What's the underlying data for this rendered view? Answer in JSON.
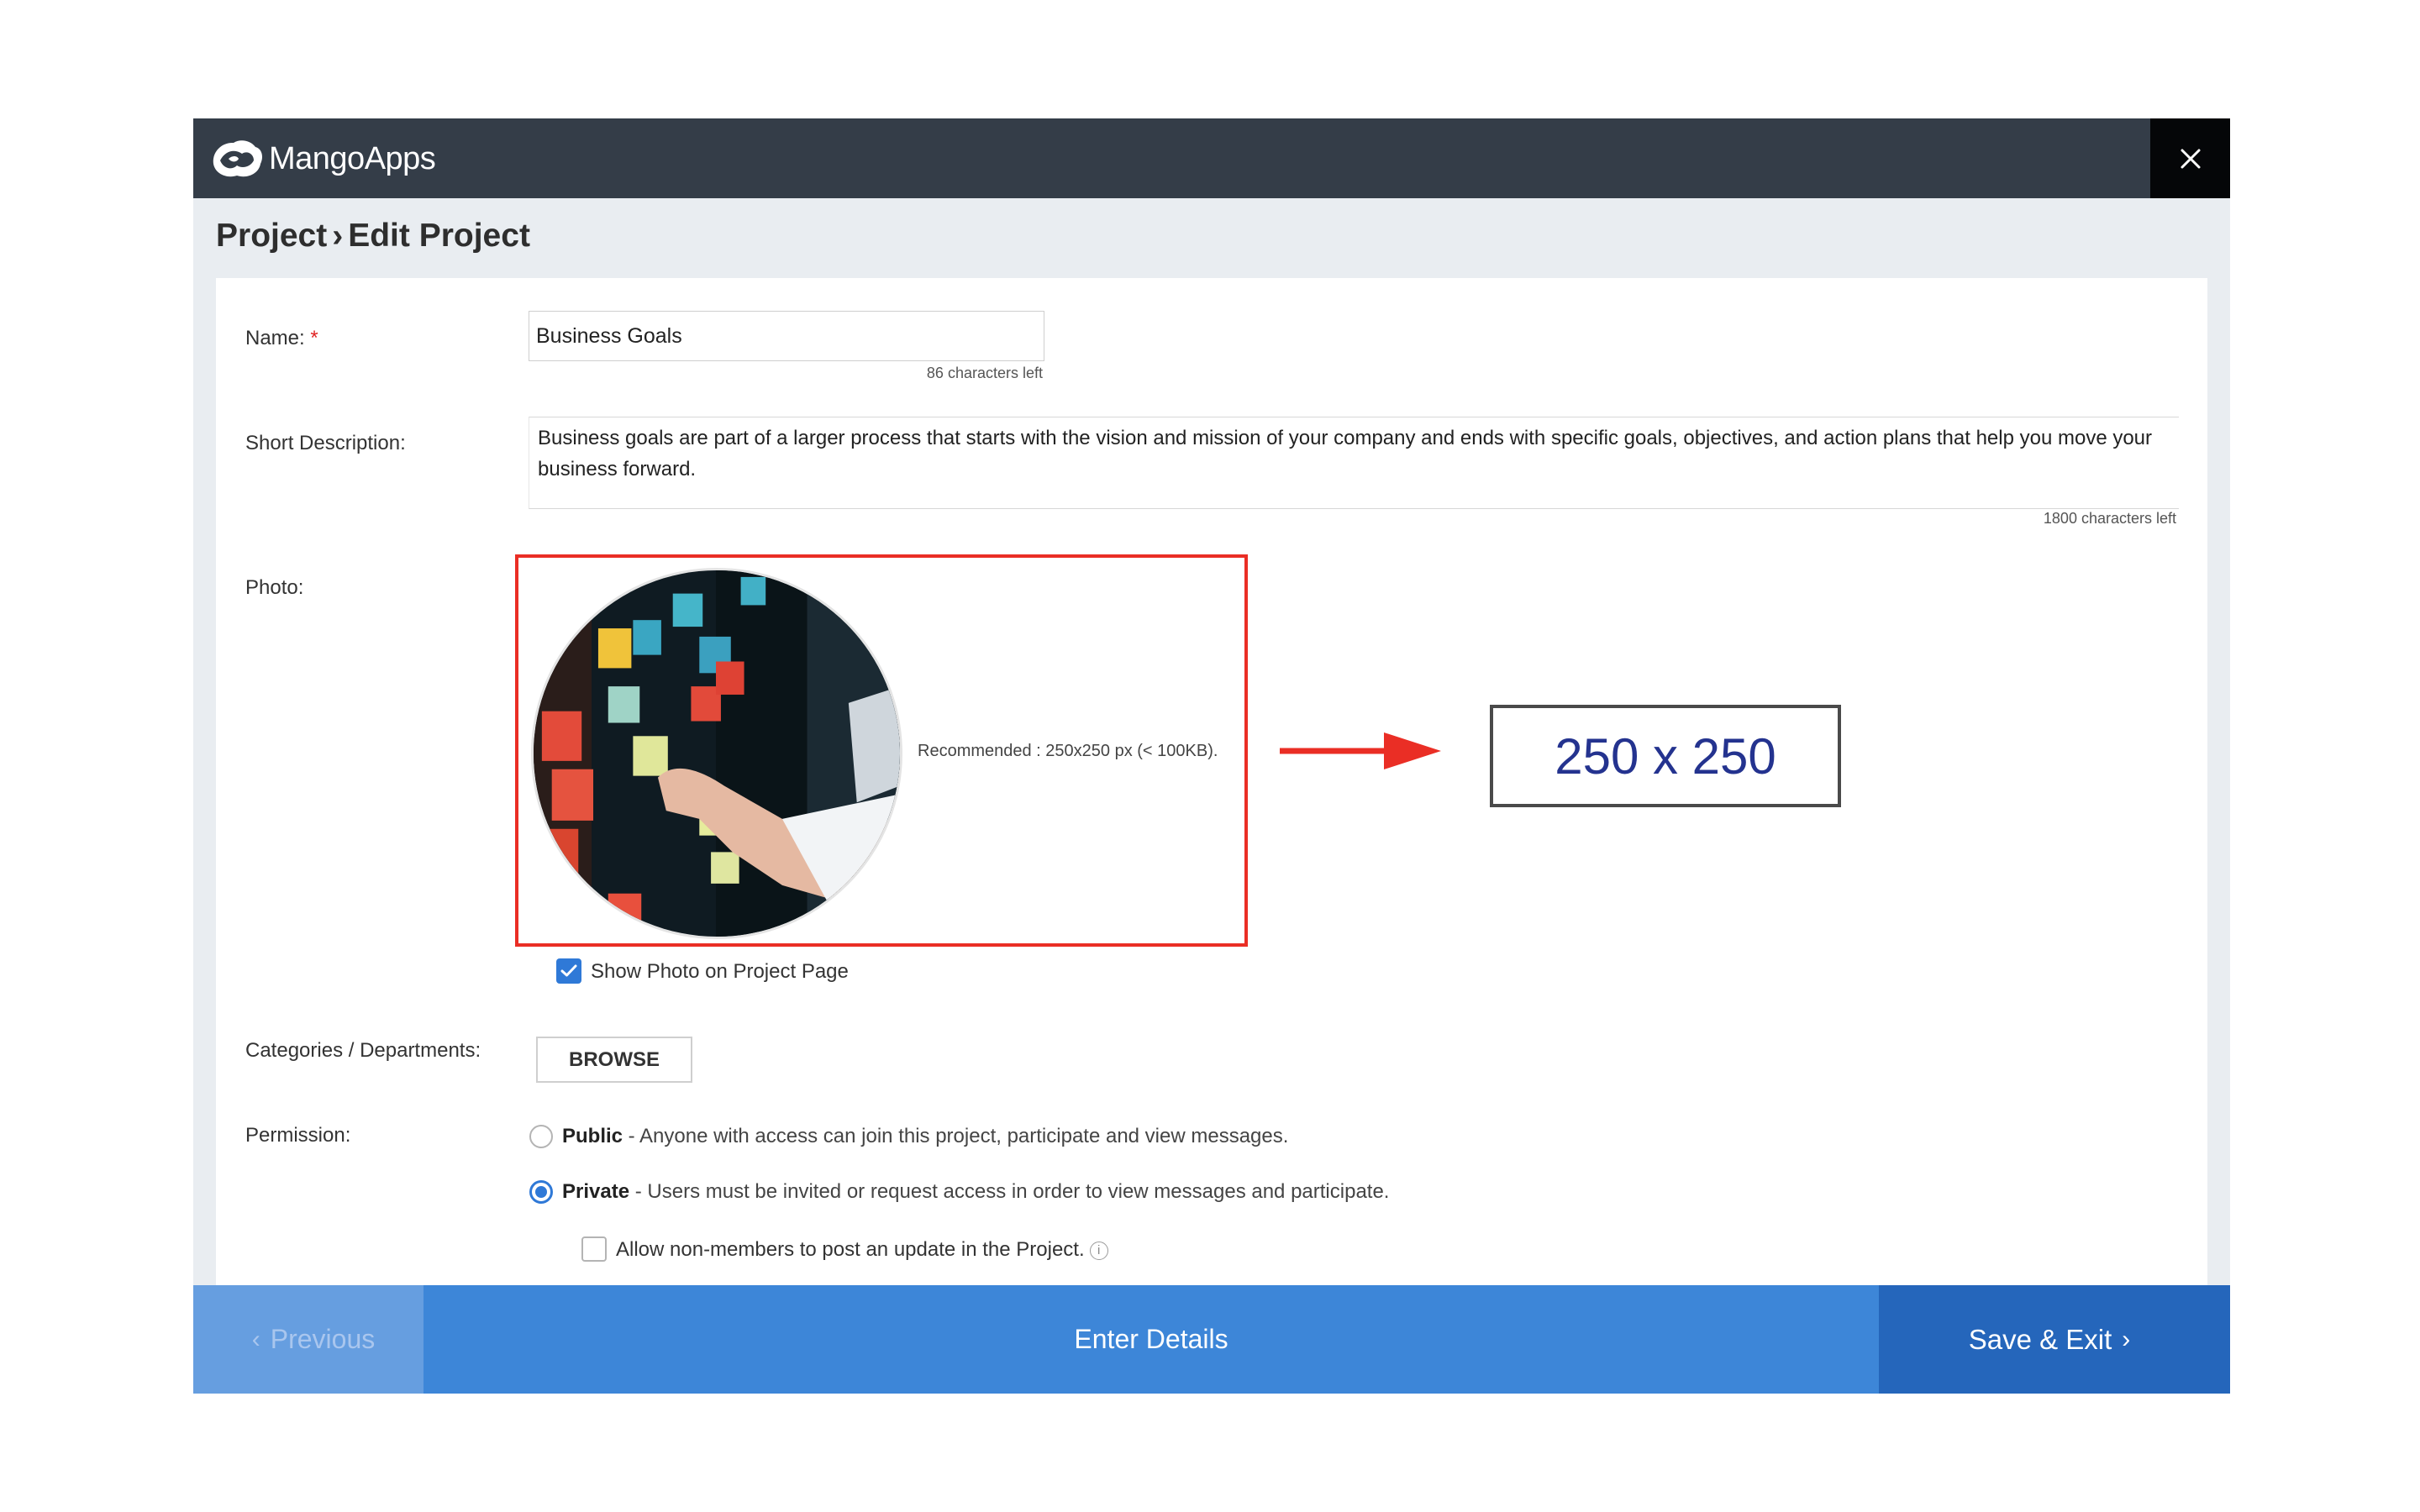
{
  "app": {
    "name": "MangoApps"
  },
  "breadcrumb": {
    "parent": "Project",
    "separator": "›",
    "current": "Edit Project"
  },
  "form": {
    "name": {
      "label": "Name:",
      "required_mark": "*",
      "value": "Business Goals",
      "counter": "86 characters left"
    },
    "short_description": {
      "label": "Short Description:",
      "value": "Business goals are part of a larger process that starts with the vision and mission of your company and ends with specific goals, objectives, and action plans that help you move your business forward.",
      "counter": "1800 characters left"
    },
    "photo": {
      "label": "Photo:",
      "recommendation": "Recommended : 250x250 px (< 100KB).",
      "show_on_page": {
        "label": "Show Photo on Project Page",
        "checked": true
      }
    },
    "categories": {
      "label": "Categories / Departments:",
      "button": "BROWSE"
    },
    "permission": {
      "label": "Permission:",
      "options": [
        {
          "title": "Public",
          "desc": " - Anyone with access can join this project, participate and view messages.",
          "selected": false
        },
        {
          "title": "Private",
          "desc": " - Users must be invited or request access in order to view messages and participate.",
          "selected": true
        }
      ],
      "allow_non_members": {
        "label": "Allow non-members to post an update in the Project.",
        "checked": false,
        "info_icon": "i"
      }
    }
  },
  "annotation": {
    "size_text": "250 x 250",
    "highlight_color": "#ea2e25",
    "text_color": "#24338f"
  },
  "footer": {
    "previous": "Previous",
    "step": "Enter Details",
    "save": "Save & Exit"
  },
  "icons": {
    "close": "close-icon",
    "prev": "chevron-left-icon",
    "next": "chevron-right-icon",
    "check": "checkmark-icon"
  },
  "colors": {
    "topbar": "#343d48",
    "footer": "#3d86d8",
    "save": "#2566bb",
    "accent": "#2f79d7"
  }
}
